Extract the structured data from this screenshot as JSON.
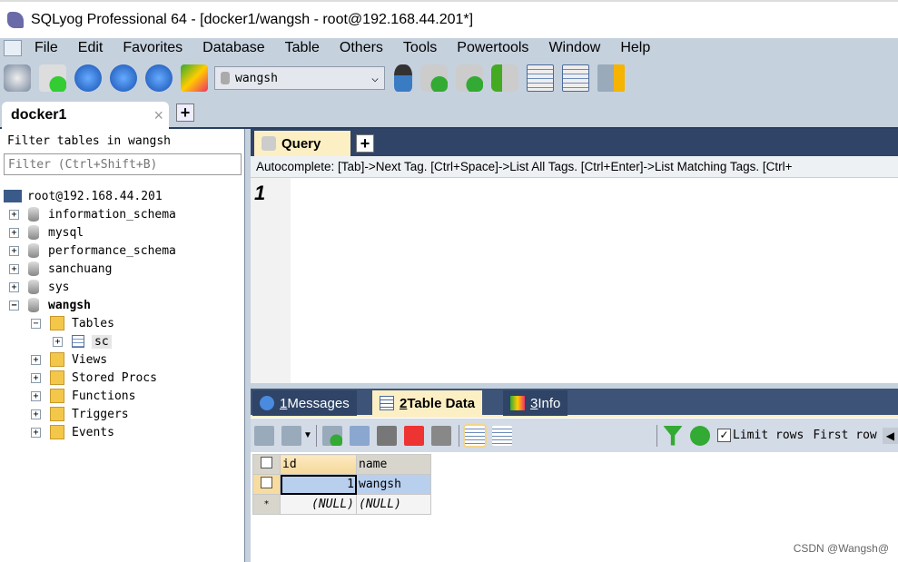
{
  "window": {
    "title": "SQLyog Professional 64 - [docker1/wangsh - root@192.168.44.201*]"
  },
  "menu": [
    "File",
    "Edit",
    "Favorites",
    "Database",
    "Table",
    "Others",
    "Tools",
    "Powertools",
    "Window",
    "Help"
  ],
  "toolbar": {
    "database_selector": "wangsh"
  },
  "connection_tab": {
    "label": "docker1",
    "close": "×",
    "add": "+"
  },
  "object_browser": {
    "filter_label": "Filter tables in wangsh",
    "filter_placeholder": "Filter (Ctrl+Shift+B)",
    "server": "root@192.168.44.201",
    "databases": [
      "information_schema",
      "mysql",
      "performance_schema",
      "sanchuang",
      "sys",
      "wangsh"
    ],
    "wangsh_children": [
      "Tables",
      "Views",
      "Stored Procs",
      "Functions",
      "Triggers",
      "Events"
    ],
    "tables": [
      "sc"
    ]
  },
  "query": {
    "tab": "Query",
    "add": "+",
    "autocomplete": "Autocomplete: [Tab]->Next Tag. [Ctrl+Space]->List All Tags. [Ctrl+Enter]->List Matching Tags. [Ctrl+",
    "line_number": "1"
  },
  "result_tabs": [
    {
      "num": "1",
      "label": " Messages"
    },
    {
      "num": "2",
      "label": " Table Data"
    },
    {
      "num": "3",
      "label": " Info"
    }
  ],
  "result_toolbar": {
    "limit_rows": "Limit rows",
    "first_row": "First row"
  },
  "grid": {
    "columns": [
      "id",
      "name"
    ],
    "rows": [
      [
        "1",
        "wangsh"
      ],
      [
        "(NULL)",
        "(NULL)"
      ]
    ],
    "new_row_marker": "*"
  },
  "watermark": "CSDN @Wangsh@"
}
